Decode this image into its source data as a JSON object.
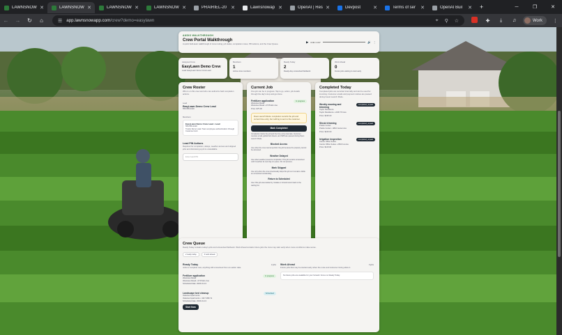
{
  "browser": {
    "tabs": [
      {
        "title": "LAWNSNOW",
        "fav": "#2d7a3a",
        "active": false
      },
      {
        "title": "LAWNSNOW",
        "fav": "#2d7a3a",
        "active": true
      },
      {
        "title": "LAWNSNOW",
        "fav": "#2d7a3a",
        "active": false
      },
      {
        "title": "LAWNSNOW",
        "fav": "#2d7a3a",
        "active": false
      },
      {
        "title": "PRAIRIEL-20",
        "fav": "#9aa0a6",
        "active": false
      },
      {
        "title": "Lawnsnowap",
        "fav": "#e8eaed",
        "active": false
      },
      {
        "title": "OpenAI | Res",
        "fav": "#9aa0a6",
        "active": false
      },
      {
        "title": "Devpost",
        "fav": "#1a73e8",
        "active": false
      },
      {
        "title": "Terms of ser",
        "fav": "#1a73e8",
        "active": false
      },
      {
        "title": "OpenAI Buil",
        "fav": "#9aa0a6",
        "active": false
      }
    ],
    "url_host": "app.lawnsnowapp.com",
    "url_path": "/crew?demo=easylawn",
    "profile": "Work"
  },
  "walkthrough": {
    "kicker": "AUDIO WALKTHROUGH",
    "title": "Crew Portal Walkthrough",
    "description": "A quick field-team walkthrough of crew routing, job status, completion notes, PIN actions, and the Crew Queue.",
    "time": "0:00 / 4:07"
  },
  "stats": [
    {
      "label": "Assigned Crew",
      "value": "EasyLawn Demo Crew",
      "note": "Lead: EasyLawn Demo Crew Lead"
    },
    {
      "label": "Members",
      "value": "1",
      "note": "Active crew members"
    },
    {
      "label": "Ready Today",
      "value": "2",
      "note": "Ready-day unresolved fieldwork"
    },
    {
      "label": "Work Ahead",
      "value": "0",
      "note": "Future jobs waiting to start early"
    }
  ],
  "roster": {
    "title": "Crew Roster",
    "desc": "Who is on this crew and who can authorize field completion actions.",
    "lead_label": "Lead",
    "lead_name": "EasyLawn Demo Crew Lead",
    "lead_phone": "555-555-0100",
    "members_label": "Members",
    "member_name": "EasyLawn Demo Crew Lead • Lead",
    "member_phone": "555-555-0100",
    "member_note": "Tracks Demo Lawn Team employee authentication through Customer Hub",
    "pin_title": "Lead PIN Actions",
    "pin_desc": "Required for completion, delays, weather access and skipped jobs and dismissing a job to unavailable.",
    "pin_placeholder": "Enter lead PIN"
  },
  "current": {
    "title": "Current Job",
    "desc": "One job can be in progress. Tap to go, action, job details through the day's stop and get done.",
    "job_name": "Fertilizer application",
    "job_status": "In progress",
    "job_client": "Westview Retail",
    "job_site": "Westview Retail • 2715 Elm Ave",
    "job_price": "Price: $75.00",
    "note": "Does Launch Mode: completion records the job and current time entry, but nothing is sent to the customer.",
    "mark_btn": "Mark Completed",
    "mark_desc": "Completion tracks the job and the time entry internally. Customer receives email, global fact sheets, and SMS are queued during Open Launch Mode.",
    "blocked_btn": "Blocked Access",
    "blocked_desc": "Use when the crew cannot perform the job because the property cannot be accessed.",
    "weather_btn": "Weather Delayed",
    "weather_desc": "Use when weather prevents completion. This job remains unresolved until it reaches its next day on queue. Do not process.",
    "skip_btn": "Mark Skipped",
    "skip_desc": "Use only when the crew intentionally skips this job so it remains visible as unresolved outstanding.",
    "return_btn": "Return to Scheduled",
    "return_desc": "Use if the job was started by mistake or should return back to the waiting list."
  },
  "completed": {
    "title": "Completed Today",
    "desc": "Completed jobs are recorded internally and can be used for invoicing. Customer emails and payment notices are paused during Guest Launch Mode.",
    "items": [
      {
        "name": "Weekly mowing and trimming",
        "badge": "completed_unpaid",
        "client": "Taylor Residence",
        "site": "Taylor Residence • 2230 7th Ave",
        "price": "Price: $195.00"
      },
      {
        "name": "Shrub trimming",
        "badge": "completed_unpaid",
        "client": "Prairie Center",
        "site": "Prairie Center • 4810 Center Ave",
        "price": "Price: $160.00"
      },
      {
        "name": "Irrigation inspection",
        "badge": "completed_unpaid",
        "client": "Centre Office Suites",
        "site": "Centre Office Suites • 2500 1st Ave",
        "price": "Price: $115.00"
      }
    ]
  },
  "queue": {
    "title": "Crew Queue",
    "desc": "Ready Today contains today's jobs and unresolved fieldwork. Work Ahead contains future jobs the crew may start early when route conditions make sense.",
    "chip1": "2 ready today",
    "chip2": "0 work ahead",
    "ready_title": "Ready Today",
    "ready_count": "2 jobs",
    "ready_desc": "Jobs to complete now, anything still unresolved from an earlier date.",
    "ahead_title": "Work Ahead",
    "ahead_count": "0 jobs",
    "ahead_desc": "Future jobs that may be started early when the route and customer timing allow it.",
    "ahead_empty": "No future jobs are available for your forward. Focus on Ready Today.",
    "jobs": [
      {
        "name": "Fertilizer application",
        "badge": "In progress",
        "client": "Westview Retail",
        "site": "Westview Retail • 2715 Elm Ave",
        "date": "Scheduled date: 2026-01-13"
      },
      {
        "name": "Landscape bed cleanup",
        "badge": "Scheduled",
        "client": "Oakview Apartments",
        "site": "Oakview Apartments • 4117 28th St",
        "date": "Scheduled date: 2026-01-13",
        "action": "Start Now"
      }
    ]
  }
}
